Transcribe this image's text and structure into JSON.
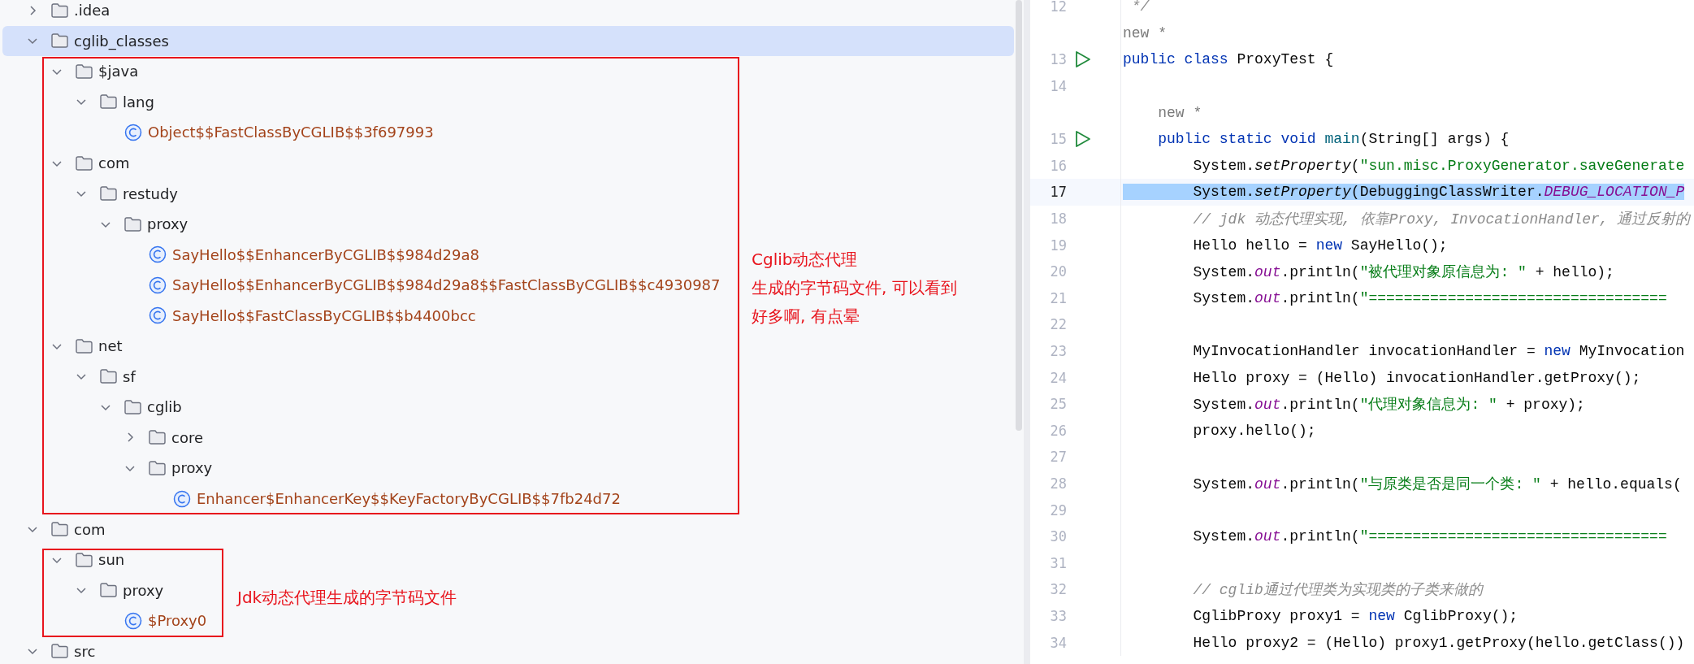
{
  "project_tree": {
    "items": [
      {
        "kind": "folder",
        "label": ".idea",
        "expanded": false,
        "selected": false
      },
      {
        "kind": "folder",
        "label": "cglib_classes",
        "expanded": true,
        "selected": true,
        "children": [
          {
            "kind": "folder",
            "label": "$java",
            "expanded": true,
            "selected": false,
            "children": [
              {
                "kind": "folder",
                "label": "lang",
                "expanded": true,
                "selected": false,
                "children": [
                  {
                    "kind": "class",
                    "label": "Object$$FastClassByCGLIB$$3f697993",
                    "selected": false
                  }
                ]
              }
            ]
          },
          {
            "kind": "folder",
            "label": "com",
            "expanded": true,
            "selected": false,
            "children": [
              {
                "kind": "folder",
                "label": "restudy",
                "expanded": true,
                "selected": false,
                "children": [
                  {
                    "kind": "folder",
                    "label": "proxy",
                    "expanded": true,
                    "selected": false,
                    "children": [
                      {
                        "kind": "class",
                        "label": "SayHello$$EnhancerByCGLIB$$984d29a8",
                        "selected": false
                      },
                      {
                        "kind": "class",
                        "label": "SayHello$$EnhancerByCGLIB$$984d29a8$$FastClassByCGLIB$$c4930987",
                        "selected": false
                      },
                      {
                        "kind": "class",
                        "label": "SayHello$$FastClassByCGLIB$$b4400bcc",
                        "selected": false
                      }
                    ]
                  }
                ]
              }
            ]
          },
          {
            "kind": "folder",
            "label": "net",
            "expanded": true,
            "selected": false,
            "children": [
              {
                "kind": "folder",
                "label": "sf",
                "expanded": true,
                "selected": false,
                "children": [
                  {
                    "kind": "folder",
                    "label": "cglib",
                    "expanded": true,
                    "selected": false,
                    "children": [
                      {
                        "kind": "folder",
                        "label": "core",
                        "expanded": false,
                        "selected": false
                      },
                      {
                        "kind": "folder",
                        "label": "proxy",
                        "expanded": true,
                        "selected": false,
                        "children": [
                          {
                            "kind": "class",
                            "label": "Enhancer$EnhancerKey$$KeyFactoryByCGLIB$$7fb24d72",
                            "selected": false
                          }
                        ]
                      }
                    ]
                  }
                ]
              }
            ]
          }
        ]
      },
      {
        "kind": "folder",
        "label": "com",
        "expanded": true,
        "selected": false,
        "children": [
          {
            "kind": "folder",
            "label": "sun",
            "expanded": true,
            "selected": false,
            "children": [
              {
                "kind": "folder",
                "label": "proxy",
                "expanded": true,
                "selected": false,
                "children": [
                  {
                    "kind": "class",
                    "label": "$Proxy0",
                    "selected": false
                  }
                ]
              }
            ]
          }
        ]
      },
      {
        "kind": "folder",
        "label": "src",
        "expanded": true,
        "selected": false
      }
    ]
  },
  "annotations": [
    {
      "lines": [
        "Cglib动态代理",
        "生成的字节码文件, 可以看到",
        "好多啊, 有点晕"
      ]
    },
    {
      "lines": [
        "Jdk动态代理生成的字节码文件"
      ]
    }
  ],
  "editor": {
    "lines": [
      {
        "kind": "code",
        "number": "12",
        "run": false,
        "selected": false,
        "tokens": [
          {
            "kind": "comment",
            "text": " */"
          }
        ]
      },
      {
        "kind": "hint",
        "text": "new *"
      },
      {
        "kind": "code",
        "number": "13",
        "run": true,
        "selected": false,
        "tokens": [
          {
            "kind": "keyword",
            "text": "public class"
          },
          {
            "kind": "plain",
            "text": " ProxyTest {"
          }
        ]
      },
      {
        "kind": "code",
        "number": "14",
        "run": false,
        "selected": false
      },
      {
        "kind": "hint",
        "text": "    new *"
      },
      {
        "kind": "code",
        "number": "15",
        "run": true,
        "selected": false,
        "tokens": [
          {
            "kind": "keyword",
            "text": "    public static void"
          },
          {
            "kind": "declaration",
            "text": " main"
          },
          {
            "kind": "plain",
            "text": "(String[] args) {"
          }
        ]
      },
      {
        "kind": "code",
        "number": "16",
        "run": false,
        "selected": false,
        "tokens": [
          {
            "kind": "plain",
            "text": "        System."
          },
          {
            "kind": "static",
            "text": "setProperty"
          },
          {
            "kind": "plain",
            "text": "("
          },
          {
            "kind": "string",
            "text": "\"sun.misc.ProxyGenerator.saveGenerate"
          }
        ]
      },
      {
        "kind": "code",
        "number": "17",
        "run": false,
        "selected": true,
        "tokens": [
          {
            "kind": "plain",
            "text": "        System."
          },
          {
            "kind": "static",
            "text": "setProperty"
          },
          {
            "kind": "plain",
            "text": "(DebuggingClassWriter."
          },
          {
            "kind": "field",
            "text": "DEBUG_LOCATION_P"
          }
        ]
      },
      {
        "kind": "code",
        "number": "18",
        "run": false,
        "selected": false,
        "tokens": [
          {
            "kind": "comment",
            "text": "        // jdk 动态代理实现, 依靠Proxy, InvocationHandler, 通过反射的"
          }
        ]
      },
      {
        "kind": "code",
        "number": "19",
        "run": false,
        "selected": false,
        "tokens": [
          {
            "kind": "plain",
            "text": "        Hello hello = "
          },
          {
            "kind": "keyword",
            "text": "new"
          },
          {
            "kind": "plain",
            "text": " SayHello();"
          }
        ]
      },
      {
        "kind": "code",
        "number": "20",
        "run": false,
        "selected": false,
        "tokens": [
          {
            "kind": "plain",
            "text": "        System."
          },
          {
            "kind": "field",
            "text": "out"
          },
          {
            "kind": "plain",
            "text": ".println("
          },
          {
            "kind": "string",
            "text": "\"被代理对象原信息为: \""
          },
          {
            "kind": "plain",
            "text": " + hello);"
          }
        ]
      },
      {
        "kind": "code",
        "number": "21",
        "run": false,
        "selected": false,
        "tokens": [
          {
            "kind": "plain",
            "text": "        System."
          },
          {
            "kind": "field",
            "text": "out"
          },
          {
            "kind": "plain",
            "text": ".println("
          },
          {
            "kind": "string",
            "text": "\"=================================="
          }
        ]
      },
      {
        "kind": "code",
        "number": "22",
        "run": false,
        "selected": false
      },
      {
        "kind": "code",
        "number": "23",
        "run": false,
        "selected": false,
        "tokens": [
          {
            "kind": "plain",
            "text": "        MyInvocationHandler invocationHandler = "
          },
          {
            "kind": "keyword",
            "text": "new"
          },
          {
            "kind": "plain",
            "text": " MyInvocation"
          }
        ]
      },
      {
        "kind": "code",
        "number": "24",
        "run": false,
        "selected": false,
        "tokens": [
          {
            "kind": "plain",
            "text": "        Hello proxy = (Hello) invocationHandler.getProxy();"
          }
        ]
      },
      {
        "kind": "code",
        "number": "25",
        "run": false,
        "selected": false,
        "tokens": [
          {
            "kind": "plain",
            "text": "        System."
          },
          {
            "kind": "field",
            "text": "out"
          },
          {
            "kind": "plain",
            "text": ".println("
          },
          {
            "kind": "string",
            "text": "\"代理对象信息为: \""
          },
          {
            "kind": "plain",
            "text": " + proxy);"
          }
        ]
      },
      {
        "kind": "code",
        "number": "26",
        "run": false,
        "selected": false,
        "tokens": [
          {
            "kind": "plain",
            "text": "        proxy.hello();"
          }
        ]
      },
      {
        "kind": "code",
        "number": "27",
        "run": false,
        "selected": false
      },
      {
        "kind": "code",
        "number": "28",
        "run": false,
        "selected": false,
        "tokens": [
          {
            "kind": "plain",
            "text": "        System."
          },
          {
            "kind": "field",
            "text": "out"
          },
          {
            "kind": "plain",
            "text": ".println("
          },
          {
            "kind": "string",
            "text": "\"与原类是否是同一个类: \""
          },
          {
            "kind": "plain",
            "text": " + hello.equals("
          }
        ]
      },
      {
        "kind": "code",
        "number": "29",
        "run": false,
        "selected": false
      },
      {
        "kind": "code",
        "number": "30",
        "run": false,
        "selected": false,
        "tokens": [
          {
            "kind": "plain",
            "text": "        System."
          },
          {
            "kind": "field",
            "text": "out"
          },
          {
            "kind": "plain",
            "text": ".println("
          },
          {
            "kind": "string",
            "text": "\"=================================="
          }
        ]
      },
      {
        "kind": "code",
        "number": "31",
        "run": false,
        "selected": false
      },
      {
        "kind": "code",
        "number": "32",
        "run": false,
        "selected": false,
        "tokens": [
          {
            "kind": "comment",
            "text": "        // cglib通过代理类为实现类的子类来做的"
          }
        ]
      },
      {
        "kind": "code",
        "number": "33",
        "run": false,
        "selected": false,
        "tokens": [
          {
            "kind": "plain",
            "text": "        CglibProxy proxy1 = "
          },
          {
            "kind": "keyword",
            "text": "new"
          },
          {
            "kind": "plain",
            "text": " CglibProxy();"
          }
        ]
      },
      {
        "kind": "code",
        "number": "34",
        "run": false,
        "selected": false,
        "tokens": [
          {
            "kind": "plain",
            "text": "        Hello proxy2 = (Hello) proxy1.getProxy(hello.getClass())"
          }
        ]
      }
    ]
  }
}
